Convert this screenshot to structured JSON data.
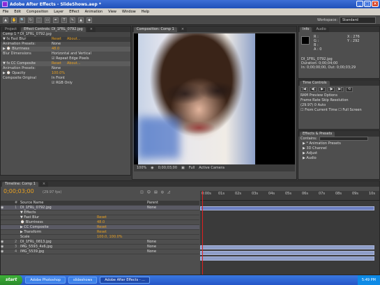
{
  "window": {
    "title": "Adobe After Effects - SlideShows.aep *"
  },
  "menu": [
    "File",
    "Edit",
    "Composition",
    "Layer",
    "Effect",
    "Animation",
    "View",
    "Window",
    "Help"
  ],
  "toolbar": {
    "tools": [
      "▲",
      "✋",
      "🔍",
      "↻",
      "⬚",
      "▭",
      "✒",
      "T",
      "✎",
      "▲",
      "◆"
    ],
    "workspace_label": "Workspace:",
    "workspace_value": "Standard"
  },
  "effect_controls": {
    "tabs": [
      "Project",
      "Effect Controls: DI_1FRL_0792.jpg",
      "×"
    ],
    "subtitle": "Comp 1 * DI_1FRL_0792.jpg",
    "rows": [
      {
        "name": "▼ fx  Fast Blur",
        "value": "Reset",
        "extra": "About...",
        "kind": "hdr"
      },
      {
        "name": "Animation Presets:",
        "value": "None",
        "extra": "",
        "kind": ""
      },
      {
        "name": "▶ ⌚ Blurriness",
        "value": "48.0",
        "extra": "",
        "kind": "sel"
      },
      {
        "name": "Blur Dimensions",
        "value": "Horizontal and Vertical",
        "extra": "",
        "kind": ""
      },
      {
        "name": "",
        "value": "☑ Repeat Edge Pixels",
        "extra": "",
        "kind": ""
      },
      {
        "name": "▼ fx  CC Composite",
        "value": "Reset",
        "extra": "About...",
        "kind": "sel"
      },
      {
        "name": "Animation Presets:",
        "value": "None",
        "extra": "",
        "kind": ""
      },
      {
        "name": "▶ ⌚ Opacity",
        "value": "100.0%",
        "extra": "",
        "kind": ""
      },
      {
        "name": "Composite Original",
        "value": "In Front",
        "extra": "",
        "kind": ""
      },
      {
        "name": "",
        "value": "☑ RGB Only",
        "extra": "",
        "kind": ""
      }
    ]
  },
  "composition": {
    "tabs": [
      "Composition: Comp 1",
      "×"
    ],
    "zoom": "100%",
    "timecode": "0;00;03;00",
    "resolution": "Full",
    "camera": "Active Camera"
  },
  "info": {
    "tabs": [
      "Info",
      "Audio"
    ],
    "lines": [
      "R :",
      "G :",
      "B :",
      "A : 0",
      "X : 276",
      "Y : 292",
      "DI_1FRL_0792.jpg",
      "Duration: 0;00;04;00",
      "In: 0;00;00;00, Out: 0;00;03;29"
    ]
  },
  "time_controls": {
    "tabs": [
      "Time Controls"
    ],
    "buttons": [
      "|◀",
      "◀|",
      "▶",
      "|▶",
      "▶|",
      "⟲"
    ],
    "rows": [
      "RAM Preview Options",
      "Frame Rate    Skip    Resolution",
      "(29.97)    0    Auto",
      "☐ From Current Time   ☐ Full Screen"
    ]
  },
  "effects_presets": {
    "tabs": [
      "Effects & Presets"
    ],
    "contains_label": "Contains:",
    "items": [
      "▶ * Animation Presets",
      "▶ 3D Channel",
      "▶ Adjust",
      "▶ Audio"
    ]
  },
  "timeline": {
    "tabs": [
      "Timeline: Comp 1",
      "×"
    ],
    "timecode": "0;00;03;00",
    "fps": "(29.97 fps)",
    "ruler": [
      "0:00s",
      "01s",
      "02s",
      "03s",
      "04s",
      "05s",
      "06s",
      "07s",
      "08s",
      "09s",
      "10s"
    ],
    "header": {
      "source": "Source Name",
      "parent": "Parent"
    },
    "rows": [
      {
        "num": "1",
        "name": "DI_1FRL_0792.jpg",
        "c4": "",
        "c5": "None",
        "kind": "sel"
      },
      {
        "num": "",
        "name": "▼ Effects",
        "c4": "",
        "c5": "",
        "kind": ""
      },
      {
        "num": "",
        "name": "▼ Fast Blur",
        "c4": "Reset",
        "c5": "",
        "kind": ""
      },
      {
        "num": "",
        "name": "⌚ Blurriness",
        "c4": "48.0",
        "c5": "",
        "kind": ""
      },
      {
        "num": "",
        "name": "▶ CC Composite",
        "c4": "Reset",
        "c5": "",
        "kind": ""
      },
      {
        "num": "",
        "name": "▶ Transform",
        "c4": "Reset",
        "c5": "",
        "kind": ""
      },
      {
        "num": "",
        "name": "Scale",
        "c4": "100.0, 100.0%",
        "c5": "",
        "kind": ""
      },
      {
        "num": "2",
        "name": "DI_1FRL_0813.jpg",
        "c4": "",
        "c5": "None",
        "kind": ""
      },
      {
        "num": "3",
        "name": "IMG_5593_4x6.jpg",
        "c4": "",
        "c5": "None",
        "kind": ""
      },
      {
        "num": "4",
        "name": "IMG_5539.jpg",
        "c4": "",
        "c5": "None",
        "kind": ""
      }
    ]
  },
  "taskbar": {
    "start": "start",
    "items": [
      "Adobe Photoshop",
      "slideshows",
      "Adobe After Effects - ..."
    ],
    "clock": "5:49 PM"
  }
}
